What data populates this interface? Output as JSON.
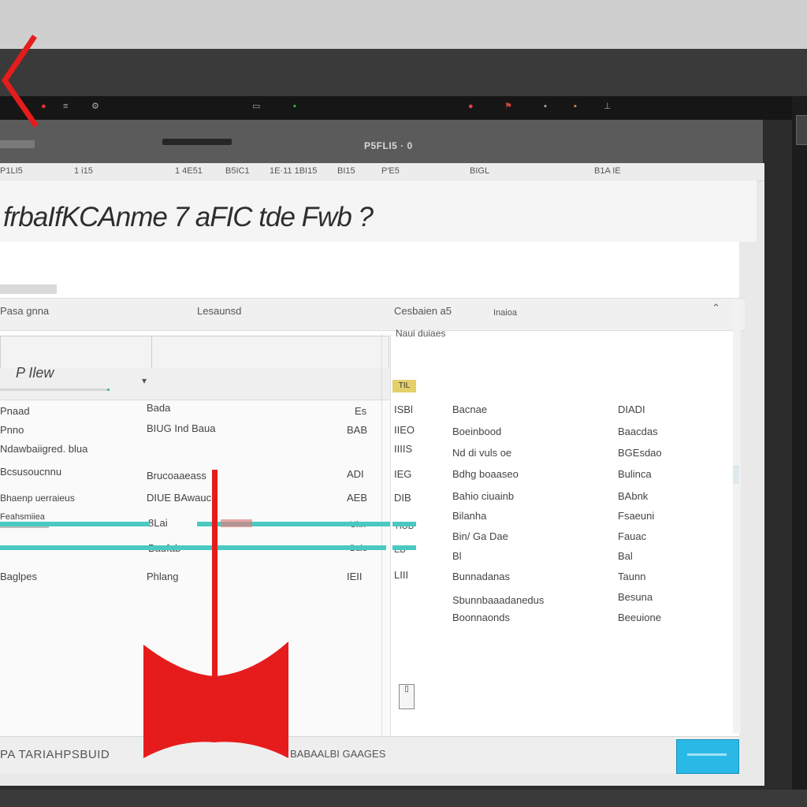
{
  "toolbar": {
    "icons": [
      "back-icon",
      "record-icon",
      "menu-icon",
      "settings-icon",
      "camera-icon",
      "lock-icon",
      "flag-icon",
      "dot-icon",
      "star-icon",
      "window-icon"
    ]
  },
  "titleband": {
    "text": "P5FLI5 · 0"
  },
  "menu": {
    "items": [
      "P1LI5",
      "1 i15",
      "1 4E51",
      "B5IC1",
      "1E·11 1BI15",
      "BI15",
      "P'E5",
      "BIGL",
      "B1A IE"
    ]
  },
  "header": {
    "title": "frbaIfKCAnme 7 aFIC tde Fwb ?"
  },
  "columns": {
    "left": "Pasa gnna",
    "middle": "Lesaunsd",
    "right_a": "Cesbaien a5",
    "right_b": "Inaioa",
    "sub": "Naui duiaes"
  },
  "filter": {
    "dropdown_label": "P Ilew"
  },
  "center_tag": "TIL",
  "rows": {
    "left": [
      "Pnaad",
      "Pnno",
      "Ndawbaiigred. blua",
      "Bcsusoucnnu",
      "Bhaenp uerraieus",
      "Feahsmiiea",
      "Baglpes"
    ],
    "mid": [
      "Bada",
      "BIUG   Ind Baua",
      "Brucoaaeass",
      "DIUE BAwauc",
      "8Lai   ",
      "Baufab   ",
      "Phlang"
    ],
    "col3": [
      "Es",
      "BAB",
      "ADI",
      "AEB",
      "Uhn",
      "Bale",
      "IEII"
    ],
    "col4": [
      "ISBl",
      "IIEO",
      "IIIIS",
      "IEG",
      "DIB",
      "TIUB",
      "EB",
      "LIII"
    ],
    "col5": [
      "Bacnae",
      "Boeinbood",
      "Nd di vuls oe",
      "Bdhg boaaseo",
      "Bahio ciuainb",
      "Bilanha",
      "Bin/ Ga Dae",
      "Bl",
      "Bunnadanas",
      "Sbunnbaaadanedus",
      "Boonnaonds"
    ],
    "col6": [
      "DIADI",
      "Baacdas",
      "BGEsdao",
      "Bulinca",
      "BAbnk",
      "Fsaeuni",
      "Fauac",
      "Bal",
      "Taunn",
      "Besuna",
      "Beeuione"
    ]
  },
  "footer": {
    "left": "PA TARIAHPSBUID",
    "mid": "BABAALBI GAAGES",
    "button_label": ""
  },
  "colors": {
    "accent_teal": "#49c9c1",
    "annotation_red": "#e61c1c",
    "button_blue": "#2ab9e6"
  }
}
